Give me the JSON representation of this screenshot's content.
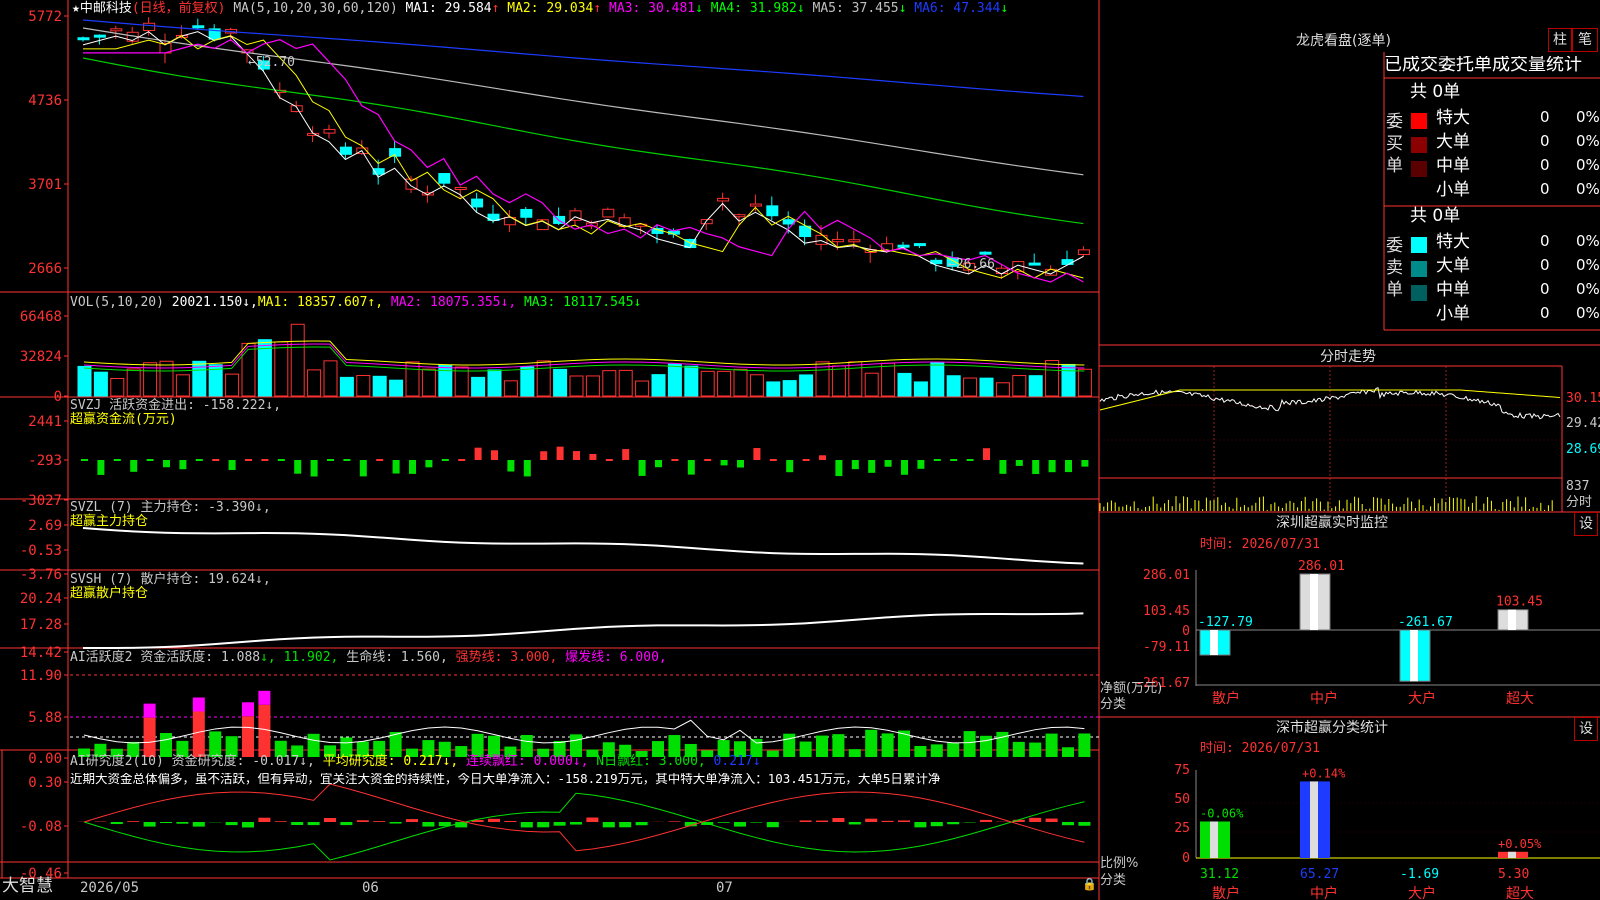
{
  "app": {
    "name": "大智慧",
    "stock": "中邮科技",
    "mode": "(日线，前复权)"
  },
  "colors": {
    "red": "#ff3232",
    "cyan": "#00ffff",
    "yellow": "#ffff00",
    "magenta": "#ff00ff",
    "green": "#00e000",
    "white": "#ffffff",
    "blue": "#1e3cff",
    "gray": "#c0c0c0"
  },
  "price_panel": {
    "ma_prefix": "MA(5,10,20,30,60,120)",
    "ma": [
      {
        "label": "MA1:",
        "value": "29.584",
        "arrow": "↑",
        "color": "#ffffff"
      },
      {
        "label": "MA2:",
        "value": "29.034",
        "arrow": "↑",
        "color": "#ffff00"
      },
      {
        "label": "MA3:",
        "value": "30.481",
        "arrow": "↓",
        "color": "#ff00ff"
      },
      {
        "label": "MA4:",
        "value": "31.982",
        "arrow": "↓",
        "color": "#00ff00"
      },
      {
        "label": "MA5:",
        "value": "37.455",
        "arrow": "↓",
        "color": "#c0c0c0"
      },
      {
        "label": "MA6:",
        "value": "47.344",
        "arrow": "↓",
        "color": "#1e3cff"
      }
    ],
    "yticks": [
      "5772",
      "4736",
      "3701",
      "2666"
    ],
    "high_label": "←52.70",
    "low_label": "←26.66"
  },
  "vol_panel": {
    "title": "VOL(5,10,20)",
    "value": "20021.150↓,",
    "ma": [
      {
        "label": "MA1:",
        "value": "18357.607↑,"
      },
      {
        "label": "MA2:",
        "value": "18075.355↓,"
      },
      {
        "label": "MA3:",
        "value": "18117.545↓"
      }
    ],
    "yticks": [
      "66468",
      "32824",
      "0"
    ]
  },
  "svzj": {
    "title": "SVZJ  活跃资金进出: -158.222↓,",
    "subtitle": "超赢资金流(万元)",
    "yticks": [
      "2441",
      "-293",
      "-3027"
    ]
  },
  "svzl": {
    "title": "SVZL (7) 主力持仓: -3.390↓,",
    "subtitle": "超赢主力持仓",
    "yticks": [
      "2.69",
      "-0.53",
      "-3.76"
    ]
  },
  "svsh": {
    "title": "SVSH (7) 散户持仓: 19.624↓,",
    "subtitle": "超赢散户持仓",
    "yticks": [
      "20.24",
      "17.28",
      "14.42"
    ]
  },
  "ai1": {
    "parts": [
      {
        "t": "AI活跃度2 资金活跃度: 1.088",
        "c": "#c8c8c8"
      },
      {
        "t": "↓, 11.902,",
        "c": "#00e000"
      },
      {
        "t": " 生命线: 1.560,",
        "c": "#c8c8c8"
      },
      {
        "t": " 强势线: 3.000,",
        "c": "#ff3232"
      },
      {
        "t": " 爆发线: 6.000,",
        "c": "#ff00ff"
      }
    ],
    "yticks": [
      "11.90",
      "5.88",
      "0.00"
    ]
  },
  "ai2": {
    "parts": [
      {
        "t": "AI研究度2(10) 资金研究度: -0.017↓,",
        "c": "#c8c8c8"
      },
      {
        "t": " 平均研究度: 0.217↓,",
        "c": "#ffff00"
      },
      {
        "t": " 连续飘红: 0.000↓,",
        "c": "#ff00ff"
      },
      {
        "t": " N日飘红: 3.000,",
        "c": "#00e000"
      },
      {
        "t": " 0.217↓",
        "c": "#1e3cff"
      }
    ],
    "desc": "近期大资金总体偏多，虽不活跃，但有异动，宜关注大资金的持续性，今日大单净流入：-158.219万元，其中特大单净流入：103.451万元，大单5日累计净",
    "yticks": [
      "0.30",
      "-0.08",
      "-0.46"
    ]
  },
  "xaxis": [
    "2026/05",
    "06",
    "07"
  ],
  "lhb": {
    "title": "龙虎看盘(逐单)",
    "btn_zhu": "柱",
    "btn_bi": "笔",
    "header": "已成交委托单成交量统计",
    "buy": {
      "label": "委买单",
      "count": "共 0单",
      "rows": [
        {
          "name": "特大",
          "v": "0",
          "p": "0%",
          "color": "#ff0000"
        },
        {
          "name": "大单",
          "v": "0",
          "p": "0%",
          "color": "#8b0000"
        },
        {
          "name": "中单",
          "v": "0",
          "p": "0%",
          "color": "#5a0000"
        },
        {
          "name": "小单",
          "v": "0",
          "p": "0%",
          "color": ""
        }
      ]
    },
    "sell": {
      "label": "委卖单",
      "count": "共 0单",
      "rows": [
        {
          "name": "特大",
          "v": "0",
          "p": "0%",
          "color": "#00ffff"
        },
        {
          "name": "大单",
          "v": "0",
          "p": "0%",
          "color": "#008b8b"
        },
        {
          "name": "中单",
          "v": "0",
          "p": "0%",
          "color": "#006060"
        },
        {
          "name": "小单",
          "v": "0",
          "p": "0%",
          "color": ""
        }
      ]
    }
  },
  "intraday": {
    "title": "分时走势",
    "yticks": [
      "30.15",
      "29.42",
      "28.69"
    ],
    "vol_tick": "837",
    "vol_label": "分时"
  },
  "sz_monitor": {
    "title": "深圳超赢实时监控",
    "settings": "设",
    "time": "时间: 2026/07/31",
    "yticks": [
      "286.01",
      "103.45",
      "0",
      "-79.11",
      "-261.67"
    ],
    "ylabel": "净额(万元)",
    "xlabel_title": "分类",
    "categories": [
      "散户",
      "中户",
      "大户",
      "超大"
    ],
    "values": [
      "-127.79",
      "286.01",
      "-261.67",
      "103.45"
    ]
  },
  "sz_class": {
    "title": "深市超赢分类统计",
    "settings": "设",
    "time": "时间: 2026/07/31",
    "yticks": [
      "75",
      "50",
      "25",
      "0"
    ],
    "ylabel": "比例%",
    "xlabel_title": "分类",
    "categories": [
      "散户",
      "中户",
      "大户",
      "超大"
    ],
    "values": [
      "31.12",
      "65.27",
      "-1.69",
      "5.30"
    ],
    "changes": [
      "-0.06%",
      "+0.14%",
      "",
      "+0.05%"
    ]
  },
  "chart_data": {
    "type": "bar",
    "title": "深圳超赢实时监控",
    "categories": [
      "散户",
      "中户",
      "大户",
      "超大"
    ],
    "series": [
      {
        "name": "净额(万元)",
        "values": [
          -127.79,
          286.01,
          -261.67,
          103.45
        ]
      },
      {
        "name": "比例%",
        "values": [
          31.12,
          65.27,
          -1.69,
          5.3
        ]
      }
    ],
    "ylim": [
      -261.67,
      286.01
    ]
  }
}
